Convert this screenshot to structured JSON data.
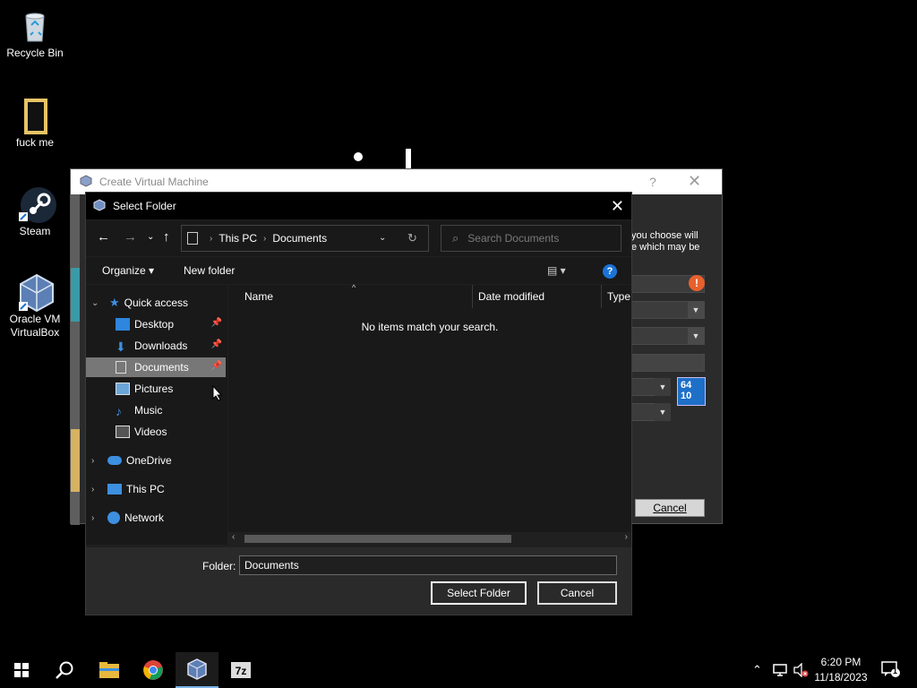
{
  "desktop": {
    "icons": [
      {
        "label": "Recycle Bin",
        "icon": "recycle-bin-icon"
      },
      {
        "label": "fuck me",
        "icon": "folder-icon"
      },
      {
        "label": "Steam",
        "icon": "steam-icon"
      },
      {
        "label": "Oracle VM VirtualBox",
        "icon": "virtualbox-icon"
      }
    ]
  },
  "vm_window": {
    "title": "Create Virtual Machine",
    "help": "?",
    "close": "✕",
    "description": "you choose will\ne which may be",
    "cancel_label": "Cancel",
    "os_badge": "64\n10"
  },
  "dialog": {
    "title": "Select Folder",
    "close": "✕",
    "address": {
      "root": "This PC",
      "current": "Documents"
    },
    "search_placeholder": "Search Documents",
    "toolbar": {
      "organize": "Organize ▾",
      "new_folder": "New folder",
      "help": "?"
    },
    "nav": {
      "quick_access": "Quick access",
      "items": [
        "Desktop",
        "Downloads",
        "Documents",
        "Pictures",
        "Music",
        "Videos"
      ],
      "onedrive": "OneDrive",
      "this_pc": "This PC",
      "network": "Network"
    },
    "columns": [
      "Name",
      "Date modified",
      "Type"
    ],
    "empty_message": "No items match your search.",
    "folder_label": "Folder:",
    "folder_value": "Documents",
    "select_button": "Select Folder",
    "cancel_button": "Cancel"
  },
  "taskbar": {
    "clock_time": "6:20 PM",
    "clock_date": "11/18/2023",
    "notification_count": "1",
    "apps": [
      "start-icon",
      "search-icon",
      "file-explorer-icon",
      "chrome-icon",
      "virtualbox-icon",
      "7zip-icon"
    ]
  },
  "colors": {
    "accent": "#1a73d9",
    "selection": "#777777",
    "dialog_bg": "#202020"
  }
}
